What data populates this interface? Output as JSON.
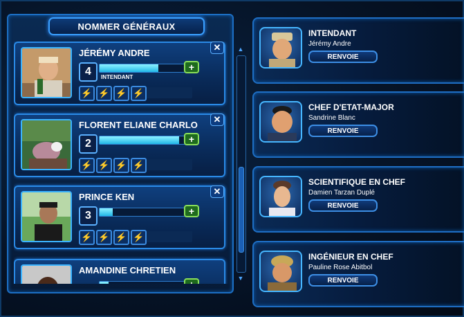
{
  "panel": {
    "title": "NOMMER GÉNÉRAUX"
  },
  "generals": [
    {
      "name": "JÉRÉMY ANDRE",
      "level": "4",
      "progress": 0.68,
      "assigned_role": "INTENDANT",
      "closable": true,
      "skill_icon": "lightning-icon"
    },
    {
      "name": "FLORENT ELIANE CHARLO",
      "level": "2",
      "progress": 0.92,
      "assigned_role": "",
      "closable": true,
      "skill_icon": "lightning-icon"
    },
    {
      "name": "PRINCE KEN",
      "level": "3",
      "progress": 0.15,
      "assigned_role": "",
      "closable": true,
      "skill_icon": "lightning-icon"
    },
    {
      "name": "AMANDINE CHRETIEN",
      "level": "",
      "progress": 0.1,
      "assigned_role": "",
      "closable": false,
      "skill_icon": "lightning-icon"
    }
  ],
  "roles": [
    {
      "title": "INTENDANT",
      "holder": "Jérémy Andre",
      "button": "RENVOIE"
    },
    {
      "title": "CHEF D'ETAT-MAJOR",
      "holder": "Sandrine Blanc",
      "button": "RENVOIE"
    },
    {
      "title": "SCIENTIFIQUE EN CHEF",
      "holder": "Damien Tarzan Duplé",
      "button": "RENVOIE"
    },
    {
      "title": "INGÉNIEUR EN CHEF",
      "holder": "Pauline Rose Abitbol",
      "button": "RENVOIE"
    }
  ],
  "icons": {
    "plus": "+",
    "close": "✕",
    "skill": "lightning-icon"
  },
  "colors": {
    "accent": "#3aa0ff",
    "plus_button": "#1e6a1e",
    "bar_fill": "#21b8e8"
  }
}
